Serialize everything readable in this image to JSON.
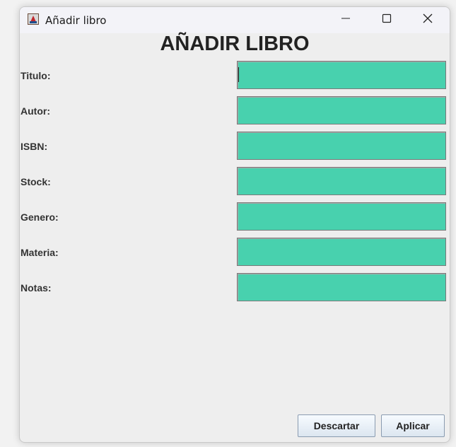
{
  "window": {
    "title": "Añadir libro"
  },
  "form": {
    "heading": "AÑADIR LIBRO",
    "fields": [
      {
        "label": "Titulo:",
        "value": "",
        "focused": true
      },
      {
        "label": "Autor:",
        "value": ""
      },
      {
        "label": "ISBN:",
        "value": ""
      },
      {
        "label": "Stock:",
        "value": ""
      },
      {
        "label": "Genero:",
        "value": ""
      },
      {
        "label": "Materia:",
        "value": ""
      },
      {
        "label": "Notas:",
        "value": ""
      }
    ],
    "field_color": "#48d1ae"
  },
  "buttons": {
    "discard": "Descartar",
    "apply": "Aplicar"
  },
  "icons": {
    "app": "java-cup-icon",
    "minimize": "minimize-icon",
    "maximize": "maximize-icon",
    "close": "close-icon"
  }
}
